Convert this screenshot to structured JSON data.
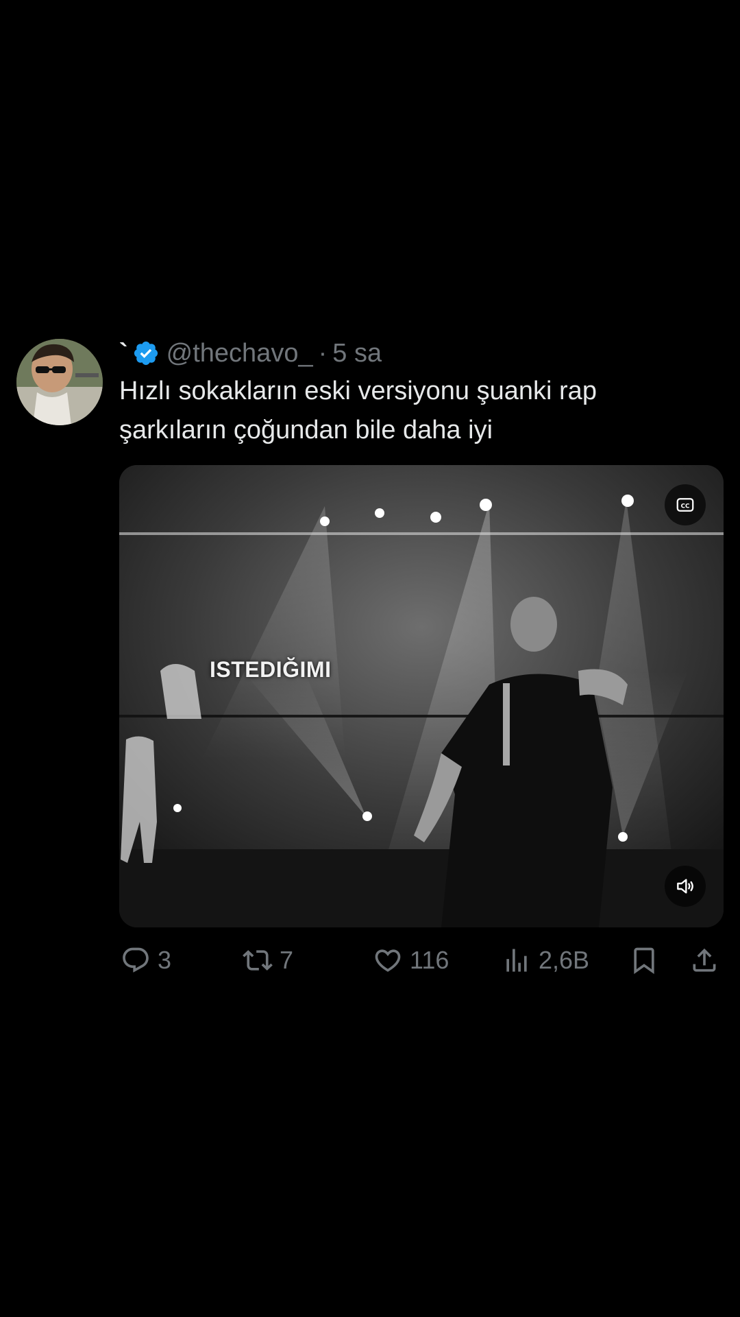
{
  "tweet": {
    "display_name": "`",
    "handle": "@thechavo_",
    "separator": "·",
    "time": "5 sa",
    "text": "Hızlı sokakların eski versiyonu şuanki rap şarkıların çoğundan bile daha iyi",
    "media": {
      "caption_overlay": "ISTEDIĞIMI",
      "cc_icon": "closed-captions-icon",
      "mute_icon": "speaker-icon"
    },
    "actions": {
      "replies": "3",
      "retweets": "7",
      "likes": "116",
      "views": "2,6B"
    }
  },
  "colors": {
    "background": "#000000",
    "text": "#e7e9ea",
    "secondary": "#71767b",
    "verified": "#1d9bf0"
  }
}
